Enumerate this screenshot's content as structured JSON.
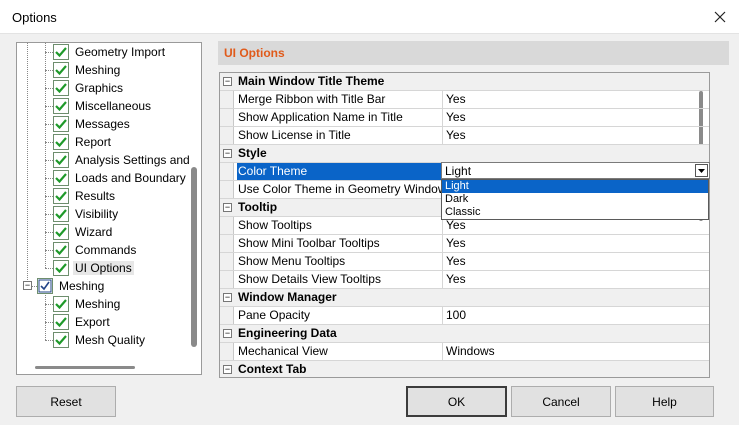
{
  "window": {
    "title": "Options"
  },
  "tree": {
    "items": [
      {
        "label": "Geometry Import",
        "type": "check"
      },
      {
        "label": "Meshing",
        "type": "check"
      },
      {
        "label": "Graphics",
        "type": "check"
      },
      {
        "label": "Miscellaneous",
        "type": "check"
      },
      {
        "label": "Messages",
        "type": "check"
      },
      {
        "label": "Report",
        "type": "check"
      },
      {
        "label": "Analysis Settings and",
        "type": "check"
      },
      {
        "label": "Loads and Boundary",
        "type": "check"
      },
      {
        "label": "Results",
        "type": "check"
      },
      {
        "label": "Visibility",
        "type": "check"
      },
      {
        "label": "Wizard",
        "type": "check"
      },
      {
        "label": "Commands",
        "type": "check"
      },
      {
        "label": "UI Options",
        "type": "check",
        "selected": true
      },
      {
        "label": "Meshing",
        "type": "folder"
      },
      {
        "label": "Meshing",
        "type": "check"
      },
      {
        "label": "Export",
        "type": "check"
      },
      {
        "label": "Mesh Quality",
        "type": "check"
      }
    ]
  },
  "panel": {
    "title": "UI Options",
    "rows": [
      {
        "section": true,
        "name": "Main Window Title Theme"
      },
      {
        "name": "Merge Ribbon with Title Bar",
        "value": "Yes"
      },
      {
        "name": "Show Application Name in Title",
        "value": "Yes"
      },
      {
        "name": "Show License in Title",
        "value": "Yes"
      },
      {
        "section": true,
        "name": "Style"
      },
      {
        "name": "Color Theme",
        "value": "",
        "selected": true
      },
      {
        "name": "Use Color Theme in Geometry Window",
        "value": ""
      },
      {
        "section": true,
        "name": "Tooltip"
      },
      {
        "name": "Show Tooltips",
        "value": "Yes"
      },
      {
        "name": "Show Mini Toolbar Tooltips",
        "value": "Yes"
      },
      {
        "name": "Show Menu Tooltips",
        "value": "Yes"
      },
      {
        "name": "Show Details View Tooltips",
        "value": "Yes"
      },
      {
        "section": true,
        "name": "Window Manager"
      },
      {
        "name": "Pane Opacity",
        "value": "100"
      },
      {
        "section": true,
        "name": "Engineering Data"
      },
      {
        "name": "Mechanical View",
        "value": "Windows"
      },
      {
        "section": true,
        "name": "Context Tab"
      }
    ],
    "dropdown": {
      "value": "Light",
      "options": [
        "Light",
        "Dark",
        "Classic"
      ],
      "highlighted": "Light"
    }
  },
  "buttons": {
    "reset": "Reset",
    "ok": "OK",
    "cancel": "Cancel",
    "help": "Help"
  },
  "colors": {
    "accent": "#0a64c8",
    "panel_title": "#e05a1a"
  }
}
